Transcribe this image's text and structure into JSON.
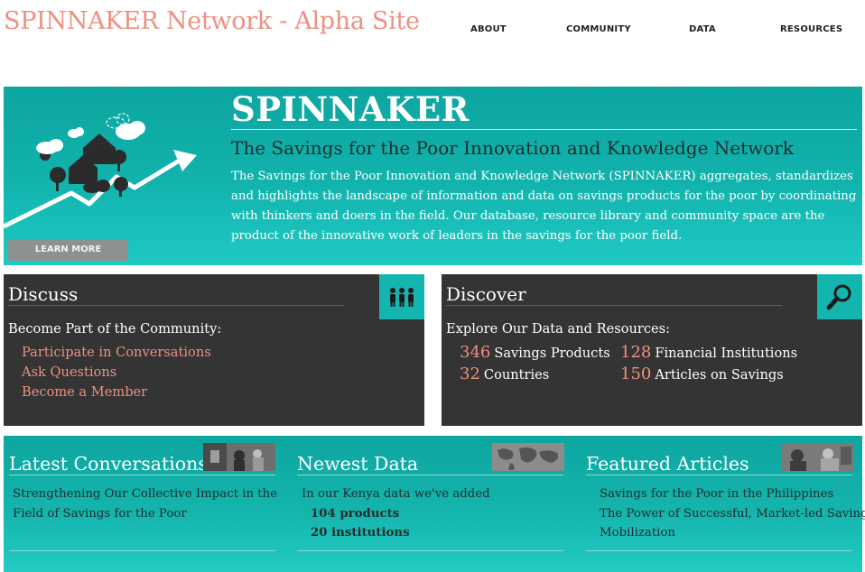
{
  "site": {
    "title": "SPINNAKER Network - Alpha Site"
  },
  "nav": {
    "items": [
      {
        "label": "ABOUT"
      },
      {
        "label": "COMMUNITY"
      },
      {
        "label": "DATA"
      },
      {
        "label": "RESOURCES"
      }
    ]
  },
  "hero": {
    "heading": "SPINNAKER",
    "subtitle": "The Savings for the Poor Innovation and Knowledge Network",
    "body": "The Savings for the Poor Innovation and Knowledge Network (SPINNAKER) aggregates, standardizes and highlights the landscape of information and data on savings products for the poor by coordinating with thinkers and doers in the field. Our database, resource library and community space are the product of the innovative work of leaders in the savings for the poor field.",
    "cta_label": "LEARN MORE"
  },
  "discuss": {
    "title": "Discuss",
    "subtitle": "Become Part of the Community:",
    "links": [
      "Participate in Conversations",
      "Ask Questions",
      "Become a Member"
    ]
  },
  "discover": {
    "title": "Discover",
    "subtitle": "Explore Our Data and Resources:",
    "stats": [
      {
        "num": "346",
        "label": "Savings Products"
      },
      {
        "num": "128",
        "label": "Financial Institutions"
      },
      {
        "num": "32",
        "label": "Countries"
      },
      {
        "num": "150",
        "label": "Articles on Savings"
      }
    ]
  },
  "columns": {
    "conversations": {
      "title": "Latest Conversations",
      "lines": [
        "Strengthening Our Collective Impact in the",
        "Field of Savings for the Poor"
      ]
    },
    "data": {
      "title": "Newest Data",
      "intro": "In our Kenya data we've added",
      "items": [
        "104 products",
        "20 institutions"
      ]
    },
    "articles": {
      "title": "Featured Articles",
      "lines": [
        "Savings for the Poor in the Philippines",
        "The Power of Successful, Market-led Savings",
        "Mobilization"
      ]
    }
  },
  "colors": {
    "accent": "#ef9080",
    "teal": "#14b5ae",
    "dark_panel": "#343434"
  },
  "icons": {
    "discuss": "people-group-icon",
    "discover": "magnifier-icon"
  }
}
